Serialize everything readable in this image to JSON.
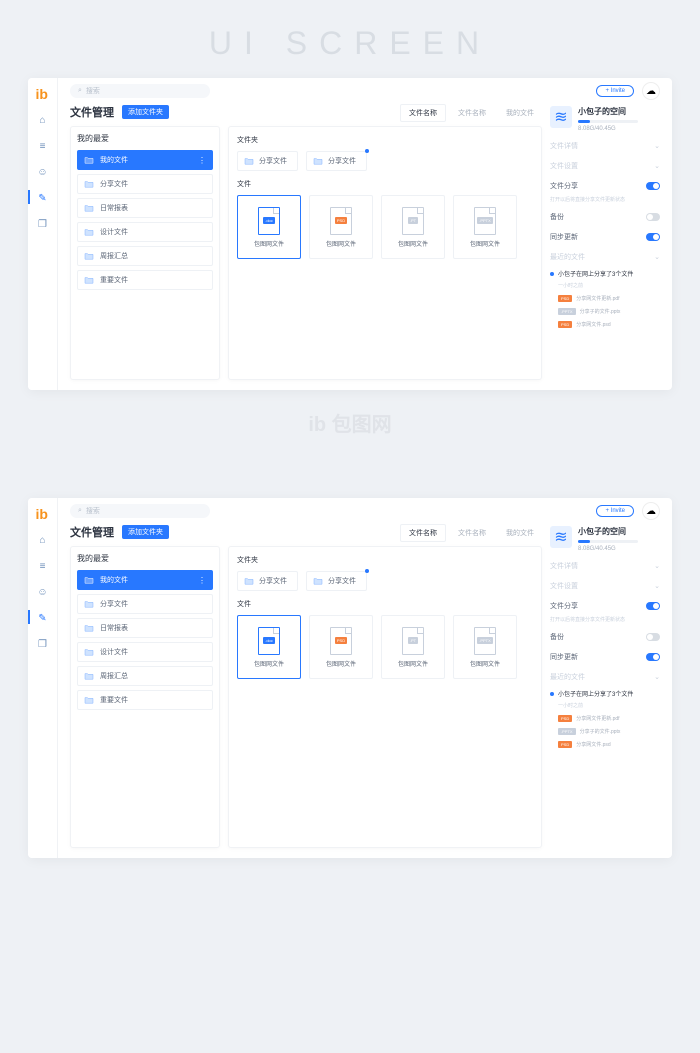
{
  "banner": "UI SCREEN",
  "watermark": "ib 包图网",
  "search": {
    "placeholder": "搜索"
  },
  "topbar": {
    "invite": "Invite"
  },
  "page": {
    "title": "文件管理",
    "add_folder": "添加文件夹"
  },
  "favorites": {
    "title": "我的最爱",
    "items": [
      {
        "label": "我的文件",
        "active": true
      },
      {
        "label": "分享文件"
      },
      {
        "label": "日常报表"
      },
      {
        "label": "设计文件"
      },
      {
        "label": "周报汇总"
      },
      {
        "label": "重要文件"
      }
    ]
  },
  "tabs": [
    {
      "label": "文件名称",
      "active": true
    },
    {
      "label": "文件名称"
    },
    {
      "label": "我的文件"
    }
  ],
  "folders": {
    "title": "文件夹",
    "items": [
      {
        "label": "分享文件"
      },
      {
        "label": "分享文件",
        "dot": true
      }
    ]
  },
  "files": {
    "title": "文件",
    "items": [
      {
        "name": "包图网文件",
        "badge": ".doc",
        "color": "#2878ff",
        "selected": true
      },
      {
        "name": "包图网文件",
        "badge": "PSD",
        "color": "#f5803e"
      },
      {
        "name": "包图网文件",
        "badge": ".PT",
        "color": "#c8d0dc"
      },
      {
        "name": "包图网文件",
        "badge": ".PPTX",
        "color": "#c8d0dc"
      }
    ]
  },
  "space": {
    "title": "小包子的空间",
    "usage": "8.08G/40.45G"
  },
  "settings": [
    {
      "label": "文件详情",
      "type": "chevron",
      "muted": true
    },
    {
      "label": "文件设置",
      "type": "chevron",
      "muted": true
    },
    {
      "label": "文件分享",
      "type": "toggle",
      "on": true,
      "desc": "打开以后将直接分享文件更新状态"
    },
    {
      "label": "备份",
      "type": "toggle",
      "on": false
    },
    {
      "label": "同步更新",
      "type": "toggle",
      "on": true
    },
    {
      "label": "最近的文件",
      "type": "chevron",
      "muted": true
    }
  ],
  "activity": {
    "text": "小包子在网上分享了3个文件",
    "time": "一小时之前",
    "files": [
      {
        "badge": "PSD",
        "color": "#f5803e",
        "name": "分享网文件更新.pdf"
      },
      {
        "badge": ".PPTX",
        "color": "#c8d0dc",
        "name": "分享子的文件.pptx"
      },
      {
        "badge": "PSD",
        "color": "#f5803e",
        "name": "分享网文件.psd"
      }
    ]
  }
}
